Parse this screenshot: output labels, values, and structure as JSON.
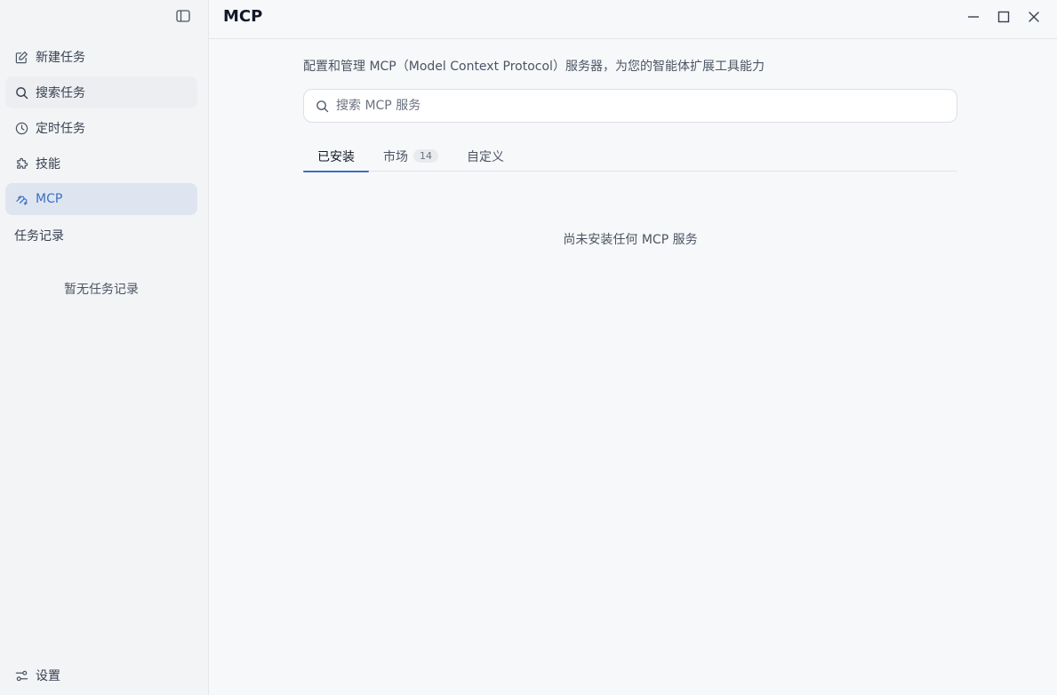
{
  "sidebar": {
    "toggle_icon": "sidebar-toggle-icon",
    "items": [
      {
        "label": "新建任务",
        "icon": "edit-icon"
      },
      {
        "label": "搜索任务",
        "icon": "search-icon"
      },
      {
        "label": "定时任务",
        "icon": "clock-icon"
      },
      {
        "label": "技能",
        "icon": "puzzle-icon"
      },
      {
        "label": "MCP",
        "icon": "mcp-icon"
      }
    ],
    "history_label": "任务记录",
    "history_empty": "暂无任务记录",
    "settings_label": "设置",
    "accent": "#3b6fc0"
  },
  "header": {
    "title": "MCP"
  },
  "main": {
    "description": "配置和管理 MCP（Model Context Protocol）服务器，为您的智能体扩展工具能力",
    "search_placeholder": "搜索 MCP 服务",
    "tabs": [
      {
        "label": "已安装",
        "active": true
      },
      {
        "label": "市场",
        "badge": "14"
      },
      {
        "label": "自定义"
      }
    ],
    "empty_message": "尚未安装任何 MCP 服务"
  }
}
